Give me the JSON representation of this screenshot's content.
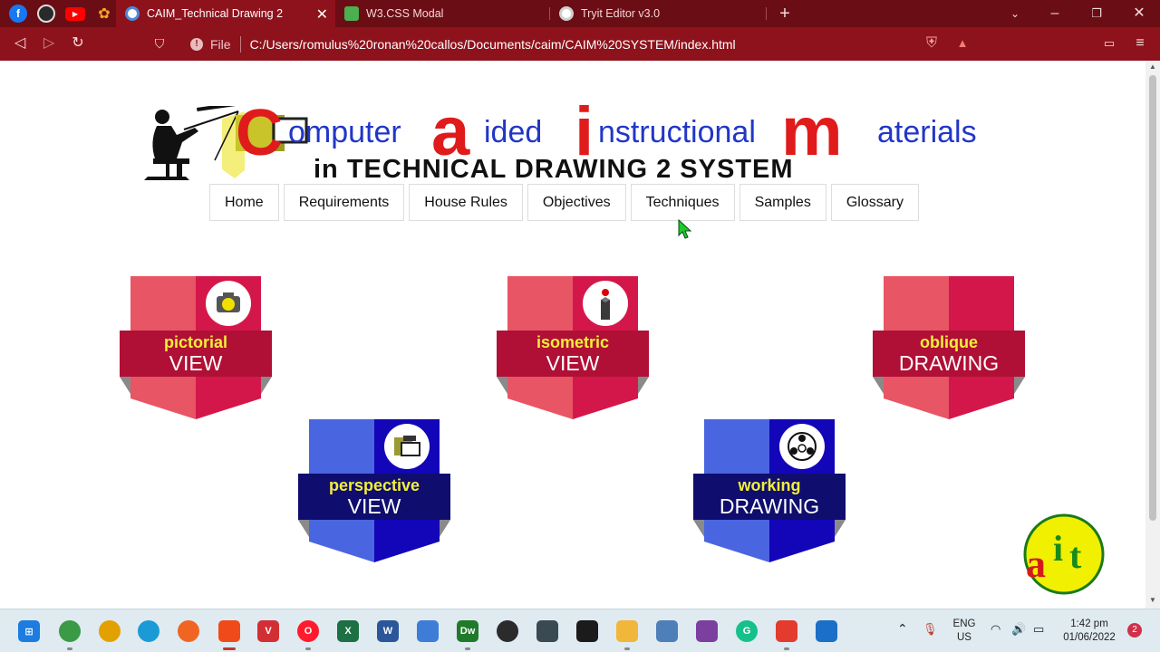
{
  "browser": {
    "tabs": [
      {
        "title": "CAIM_Technical Drawing 2",
        "active": true,
        "favicon_color": "#4d8bd8"
      },
      {
        "title": "W3.CSS Modal",
        "active": false,
        "favicon_color": "#4caf50"
      },
      {
        "title": "Tryit Editor v3.0",
        "active": false,
        "favicon_color": "#cfcfcf"
      }
    ],
    "pinned_tabs": [
      "facebook-icon",
      "globe-icon",
      "youtube-icon",
      "brave-icon"
    ],
    "address": {
      "scheme_label": "File",
      "url": "C:/Users/romulus%20ronan%20callos/Documents/caim/CAIM%20SYSTEM/index.html"
    },
    "colors": {
      "tabbar": "#6b0d14",
      "toolbar": "#8e121c"
    }
  },
  "header": {
    "logo_line1": {
      "words": [
        {
          "cap": "C",
          "rest": "omputer"
        },
        {
          "cap": "a",
          "rest": "ided"
        },
        {
          "cap": "i",
          "rest": "nstructional"
        },
        {
          "cap": "m",
          "rest": "aterials"
        }
      ]
    },
    "logo_line2": "in TECHNICAL DRAWING 2 SYSTEM",
    "colors": {
      "cap_red": "#e01b1b",
      "word_blue": "#2136c8"
    }
  },
  "menu": {
    "items": [
      "Home",
      "Requirements",
      "House Rules",
      "Objectives",
      "Techniques",
      "Samples",
      "Glossary"
    ]
  },
  "badges": [
    {
      "id": "pictorial",
      "line1": "pictorial",
      "line2": "VIEW",
      "theme": "red",
      "icon": "camera-icon"
    },
    {
      "id": "isometric",
      "line1": "isometric",
      "line2": "VIEW",
      "theme": "red",
      "icon": "isometric-block-icon"
    },
    {
      "id": "oblique",
      "line1": "oblique",
      "line2": "DRAWING",
      "theme": "red",
      "icon": ""
    },
    {
      "id": "perspective",
      "line1": "perspective",
      "line2": "VIEW",
      "theme": "blue",
      "icon": "perspective-icon"
    },
    {
      "id": "working",
      "line1": "working",
      "line2": "DRAWING",
      "theme": "blue",
      "icon": "team-icon"
    }
  ],
  "themes": {
    "red": {
      "left": "#e85565",
      "right": "#d4174a",
      "ribbon": "#b00f36",
      "fold": "#8a8a8a"
    },
    "blue": {
      "left": "#4a65e0",
      "right": "#1206b8",
      "ribbon": "#0f0d6e",
      "fold": "#8a8a8a"
    }
  },
  "corner_logo": {
    "letters": [
      "a",
      "i",
      "t"
    ]
  },
  "taskbar": {
    "tray": {
      "lang1": "ENG",
      "lang2": "US",
      "time": "1:42 pm",
      "date": "01/06/2022",
      "notifications": "2"
    },
    "icons": [
      "windows-start-icon",
      "chrome-icon",
      "chrome-canary-icon",
      "edge-icon",
      "firefox-icon",
      "brave-icon",
      "vivaldi-icon",
      "opera-icon",
      "excel-icon",
      "word-icon",
      "notepad-icon",
      "dreamweaver-icon",
      "obs-icon",
      "sublime-icon",
      "binance-icon",
      "file-explorer-icon",
      "task-manager-icon",
      "winrar-icon",
      "grammarly-icon",
      "maps-icon",
      "media-player-icon"
    ]
  }
}
